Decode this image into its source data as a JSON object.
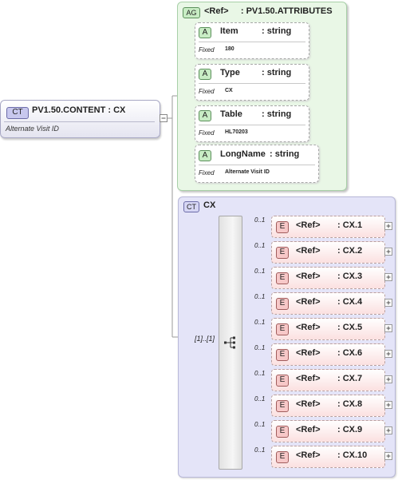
{
  "main_element": {
    "badge": "CT",
    "title": "PV1.50.CONTENT : CX",
    "documentation": "Alternate Visit ID"
  },
  "attribute_group": {
    "badge": "AG",
    "title": "<Ref>     : PV1.50.ATTRIBUTES",
    "attributes": [
      {
        "badge": "A",
        "name": "Item",
        "type": ": string",
        "fixed_label": "Fixed",
        "fixed_value": "180"
      },
      {
        "badge": "A",
        "name": "Type",
        "type": ": string",
        "fixed_label": "Fixed",
        "fixed_value": "CX"
      },
      {
        "badge": "A",
        "name": "Table",
        "type": ": string",
        "fixed_label": "Fixed",
        "fixed_value": "HL70203"
      },
      {
        "badge": "A",
        "name": "LongName",
        "type": ": string",
        "fixed_label": "Fixed",
        "fixed_value": "Alternate Visit ID"
      }
    ]
  },
  "complex_type": {
    "badge": "CT",
    "title": "CX",
    "sequence_multiplicity": "[1]..[1]",
    "elements": [
      {
        "badge": "E",
        "ref": "<Ref>",
        "name": ": CX.1",
        "multiplicity": "0..1"
      },
      {
        "badge": "E",
        "ref": "<Ref>",
        "name": ": CX.2",
        "multiplicity": "0..1"
      },
      {
        "badge": "E",
        "ref": "<Ref>",
        "name": ": CX.3",
        "multiplicity": "0..1"
      },
      {
        "badge": "E",
        "ref": "<Ref>",
        "name": ": CX.4",
        "multiplicity": "0..1"
      },
      {
        "badge": "E",
        "ref": "<Ref>",
        "name": ": CX.5",
        "multiplicity": "0..1"
      },
      {
        "badge": "E",
        "ref": "<Ref>",
        "name": ": CX.6",
        "multiplicity": "0..1"
      },
      {
        "badge": "E",
        "ref": "<Ref>",
        "name": ": CX.7",
        "multiplicity": "0..1"
      },
      {
        "badge": "E",
        "ref": "<Ref>",
        "name": ": CX.8",
        "multiplicity": "0..1"
      },
      {
        "badge": "E",
        "ref": "<Ref>",
        "name": ": CX.9",
        "multiplicity": "0..1"
      },
      {
        "badge": "E",
        "ref": "<Ref>",
        "name": ": CX.10",
        "multiplicity": "0..1"
      }
    ]
  }
}
